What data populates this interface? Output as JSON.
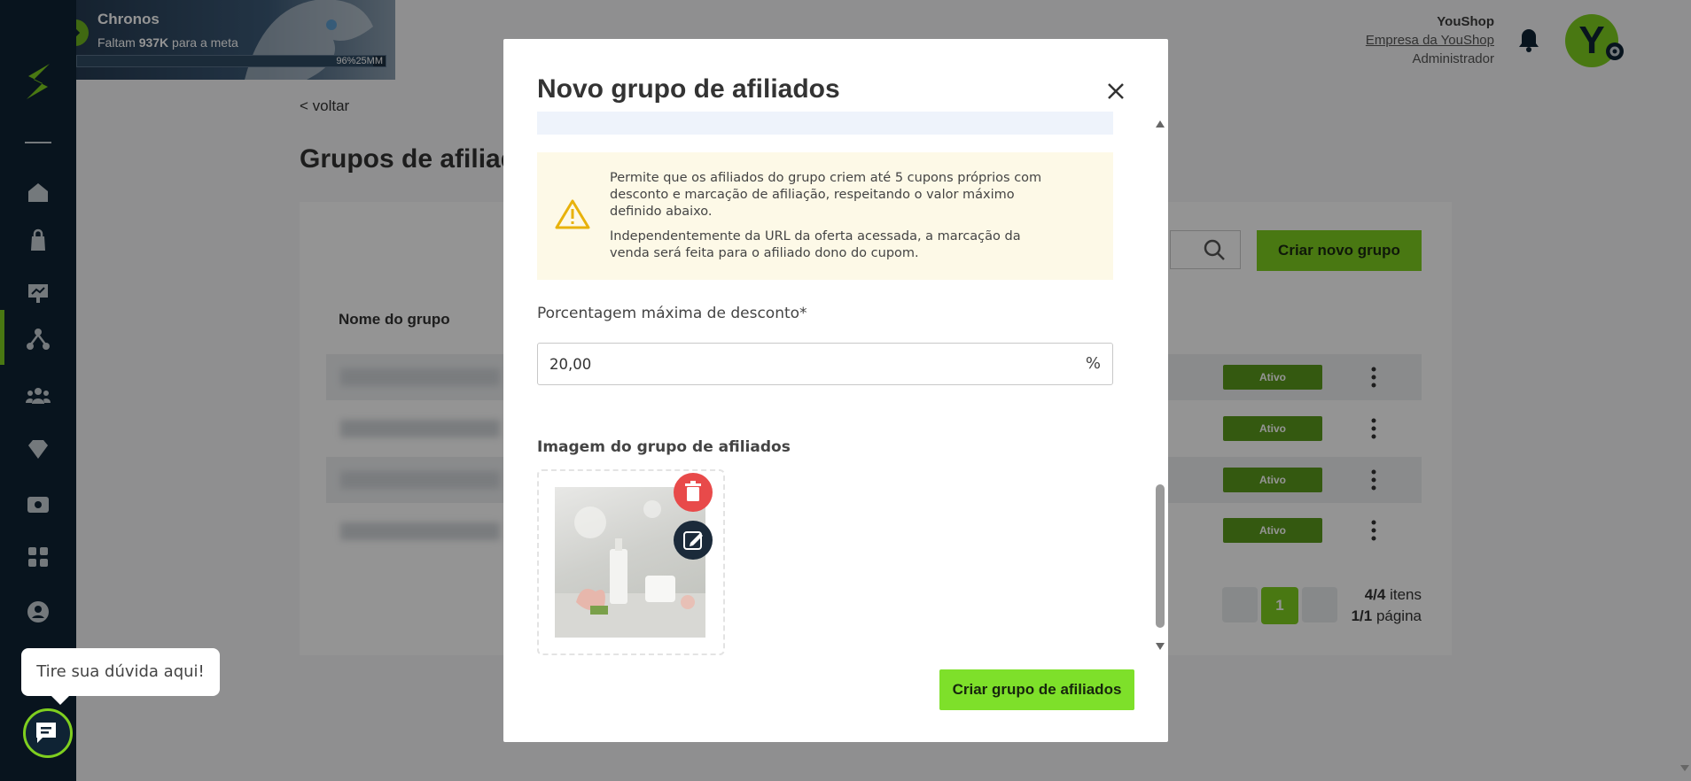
{
  "banner": {
    "title": "Chronos",
    "subtitle_prefix": "Faltam ",
    "subtitle_value": "937K",
    "subtitle_suffix": " para a meta",
    "progress_label": "96%25MM",
    "progress": 0.96
  },
  "user": {
    "name": "YouShop",
    "company": "Empresa da YouShop",
    "role": "Administrador",
    "avatar_letter": "Y"
  },
  "page": {
    "back_label": "< voltar",
    "title": "Grupos de afiliados",
    "create_button": "Criar novo grupo",
    "column_name": "Nome do grupo",
    "rows": [
      {
        "status": "Ativo"
      },
      {
        "status": "Ativo"
      },
      {
        "status": "Ativo"
      },
      {
        "status": "Ativo"
      }
    ],
    "pager": {
      "current": "1",
      "items_count": "4/4",
      "items_label": " itens",
      "pages_count": "1/1",
      "pages_label": " página"
    }
  },
  "modal": {
    "title": "Novo grupo de afiliados",
    "warning_p1": "Permite que os afiliados do grupo criem até 5 cupons próprios com desconto e marcação de afiliação, respeitando o valor máximo definido abaixo.",
    "warning_p2": "Independentemente da URL da oferta acessada, a marcação da venda será feita para o afiliado dono do cupom.",
    "discount_label": "Porcentagem máxima de desconto*",
    "discount_value": "20,00",
    "discount_unit": "%",
    "image_label": "Imagem do grupo de afiliados",
    "submit_label": "Criar grupo de afiliados"
  },
  "chat": {
    "tooltip": "Tire sua dúvida aqui!"
  },
  "colors": {
    "brand_green": "#7fcf1f",
    "sidebar_navy": "#0f2334",
    "delete_red": "#e84a4a"
  }
}
